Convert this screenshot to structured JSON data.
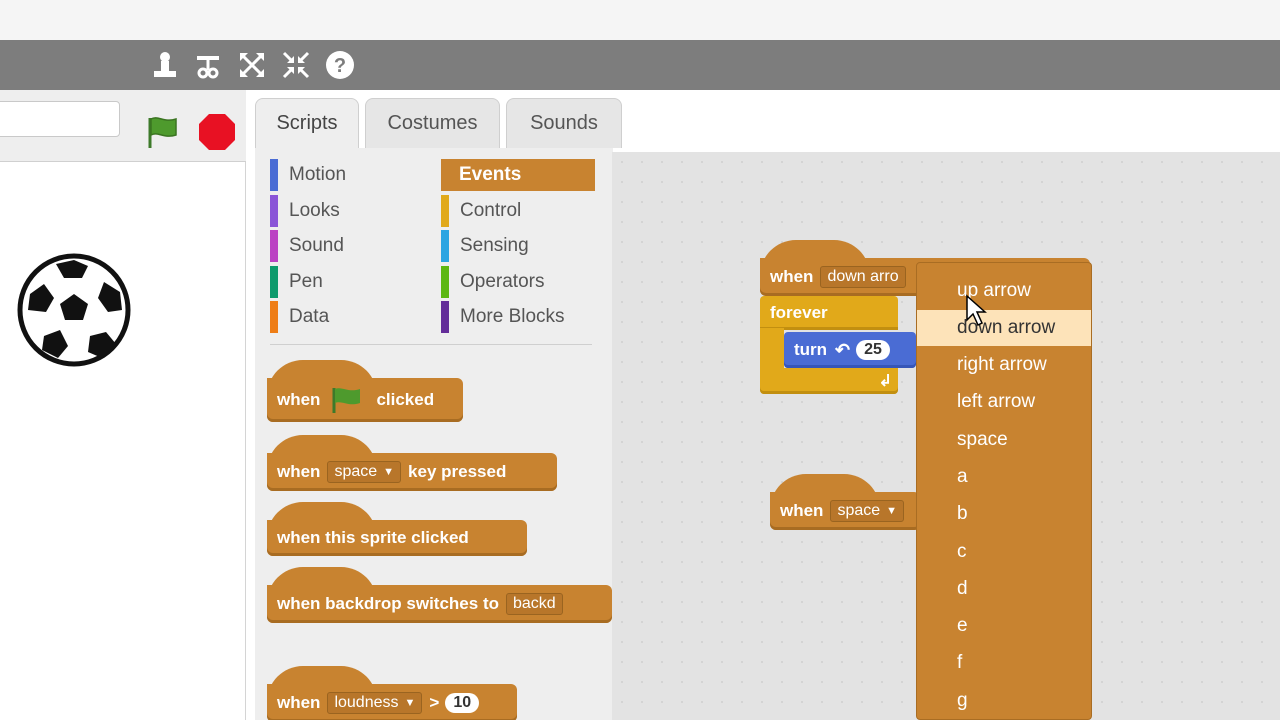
{
  "toolbar": {
    "icons": [
      "duplicate-stamp-icon",
      "cut-scissors-icon",
      "grow-icon",
      "shrink-icon",
      "help-icon"
    ]
  },
  "stage": {
    "sprite": "soccer-ball"
  },
  "tabs": [
    {
      "label": "Scripts",
      "active": true
    },
    {
      "label": "Costumes",
      "active": false
    },
    {
      "label": "Sounds",
      "active": false
    }
  ],
  "categories": {
    "left": [
      {
        "label": "Motion",
        "color": "#4a6cd4"
      },
      {
        "label": "Looks",
        "color": "#8a55d7"
      },
      {
        "label": "Sound",
        "color": "#bb42c3"
      },
      {
        "label": "Pen",
        "color": "#0e9a6c"
      },
      {
        "label": "Data",
        "color": "#ee7d16"
      }
    ],
    "right": [
      {
        "label": "Events",
        "color": "#c88330",
        "active": true
      },
      {
        "label": "Control",
        "color": "#e1a91a"
      },
      {
        "label": "Sensing",
        "color": "#2ca5e2"
      },
      {
        "label": "Operators",
        "color": "#5cb712"
      },
      {
        "label": "More Blocks",
        "color": "#632d99"
      }
    ]
  },
  "palette_blocks": {
    "flag_when": "when",
    "flag_clicked": "clicked",
    "key_when": "when",
    "key_value": "space",
    "key_pressed": "key pressed",
    "sprite_clicked": "when this sprite clicked",
    "backdrop": "when backdrop switches to",
    "backdrop_value": "backd",
    "loudness_when": "when",
    "loudness_value": "loudness",
    "loudness_op": ">",
    "loudness_num": "10"
  },
  "script": {
    "when_label": "when",
    "key_value": "down arro",
    "forever_label": "forever",
    "turn_label": "turn",
    "turn_value": "25",
    "second_when": "when",
    "second_key": "space"
  },
  "dropdown": {
    "items": [
      "up arrow",
      "down arrow",
      "right arrow",
      "left arrow",
      "space",
      "a",
      "b",
      "c",
      "d",
      "e",
      "f",
      "g"
    ],
    "selected": "down arrow"
  }
}
